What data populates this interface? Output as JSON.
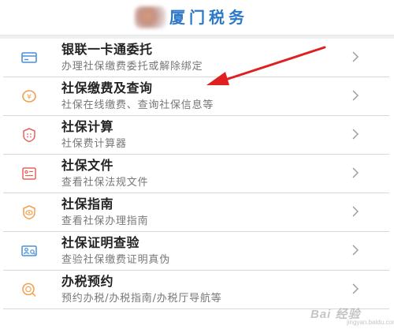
{
  "header": {
    "title": "厦门税务"
  },
  "menu": {
    "items": [
      {
        "name": "银联一卡通委托",
        "desc": "办理社保缴费委托或解除绑定",
        "icon": "card-icon"
      },
      {
        "name": "社保缴费及查询",
        "desc": "社保在线缴费、查询社保信息等",
        "icon": "payment-query-icon"
      },
      {
        "name": "社保计算",
        "desc": "社保费计算器",
        "icon": "calculator-icon"
      },
      {
        "name": "社保文件",
        "desc": "查看社保法规文件",
        "icon": "document-icon"
      },
      {
        "name": "社保指南",
        "desc": "查看社保办理指南",
        "icon": "guide-eye-icon"
      },
      {
        "name": "社保证明查验",
        "desc": "查验社保缴费证明真伪",
        "icon": "certificate-verify-icon"
      },
      {
        "name": "办税预约",
        "desc": "预约办税/办税指南/办税厅导航等",
        "icon": "appointment-icon"
      }
    ]
  },
  "colors": {
    "title": "#2c79c9",
    "icon_orange": "#f0a04b",
    "icon_red": "#e8625a",
    "icon_blue": "#4a90d9",
    "annotation_arrow": "#e02020"
  },
  "watermark": {
    "text": "Bai 经验",
    "sub": "jingyan.baidu.com"
  }
}
